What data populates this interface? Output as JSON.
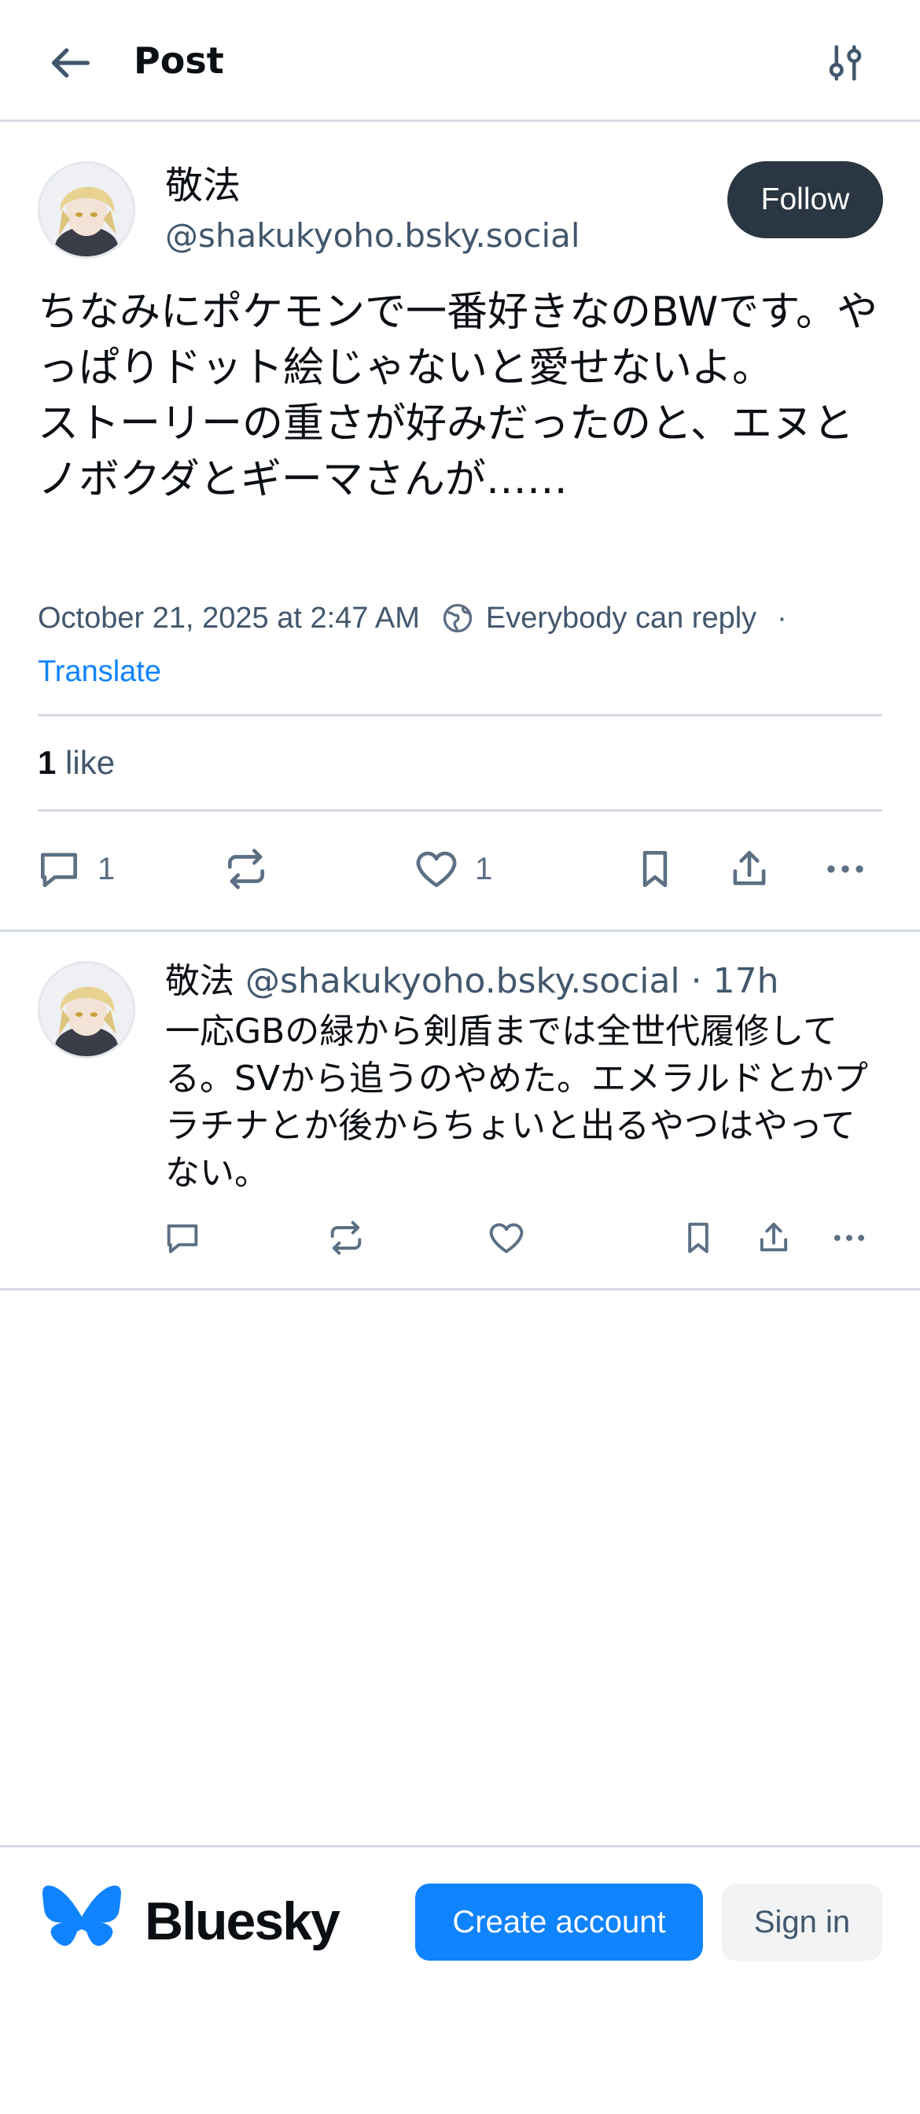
{
  "header": {
    "title": "Post",
    "back_icon": "arrow-left-icon",
    "filter_icon": "sliders-icon"
  },
  "post": {
    "author_name": "敬法",
    "author_handle": "@shakukyoho.bsky.social",
    "follow_label": "Follow",
    "text": "ちなみにポケモンで一番好きなのBWです。やっぱりドット絵じゃないと愛せないよ。\nストーリーの重さが好みだったのと、エヌとノボクダとギーマさんが……",
    "timestamp": "October 21, 2025 at 2:47 AM",
    "reply_setting": "Everybody can reply",
    "separator": "·",
    "translate_label": "Translate",
    "likes_count": "1",
    "likes_label": "like",
    "reply_count": "1",
    "like_count": "1"
  },
  "reply": {
    "author_name": "敬法",
    "author_handle": "@shakukyoho.bsky.social",
    "separator": "·",
    "time": "17h",
    "text": "一応GBの緑から剣盾までは全世代履修してる。SVから追うのやめた。エメラルドとかプラチナとか後からちょいと出るやつはやってない。"
  },
  "bottom_bar": {
    "brand": "Bluesky",
    "create_account_label": "Create account",
    "sign_in_label": "Sign in"
  },
  "colors": {
    "accent": "#1083fe",
    "follow_bg": "#2a3642",
    "muted_text": "#42576c",
    "divider": "#d4dbe2"
  }
}
